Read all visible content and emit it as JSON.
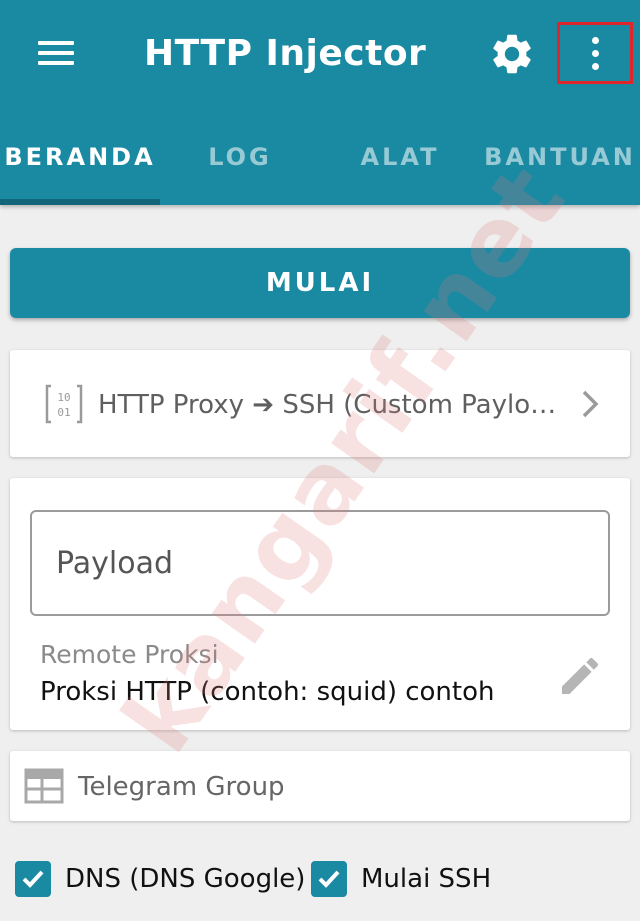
{
  "app": {
    "title": "HTTP Injector",
    "accent_color": "#1a8aa3",
    "toolbar_icons": [
      "menu-icon",
      "gear-icon",
      "more-vert-icon"
    ]
  },
  "tabs": [
    {
      "label": "BERANDA",
      "active": true
    },
    {
      "label": "LOG",
      "active": false
    },
    {
      "label": "ALAT",
      "active": false
    },
    {
      "label": "BANTUAN",
      "active": false
    }
  ],
  "start_button": {
    "label": "MULAI"
  },
  "mode": {
    "icon": "binary-icon",
    "label": "HTTP Proxy ➔ SSH (Custom Paylo…"
  },
  "payload": {
    "placeholder": "Payload"
  },
  "remote_proxy": {
    "label": "Remote Proksi",
    "value": "Proksi HTTP (contoh: squid) contoh"
  },
  "telegram": {
    "label": "Telegram Group",
    "icon": "table-icon"
  },
  "options": {
    "dns": {
      "label": "DNS (DNS Google)",
      "checked": true
    },
    "ssh": {
      "label": "Mulai SSH",
      "checked": true
    }
  },
  "watermark": {
    "text": "kangarif.net"
  }
}
